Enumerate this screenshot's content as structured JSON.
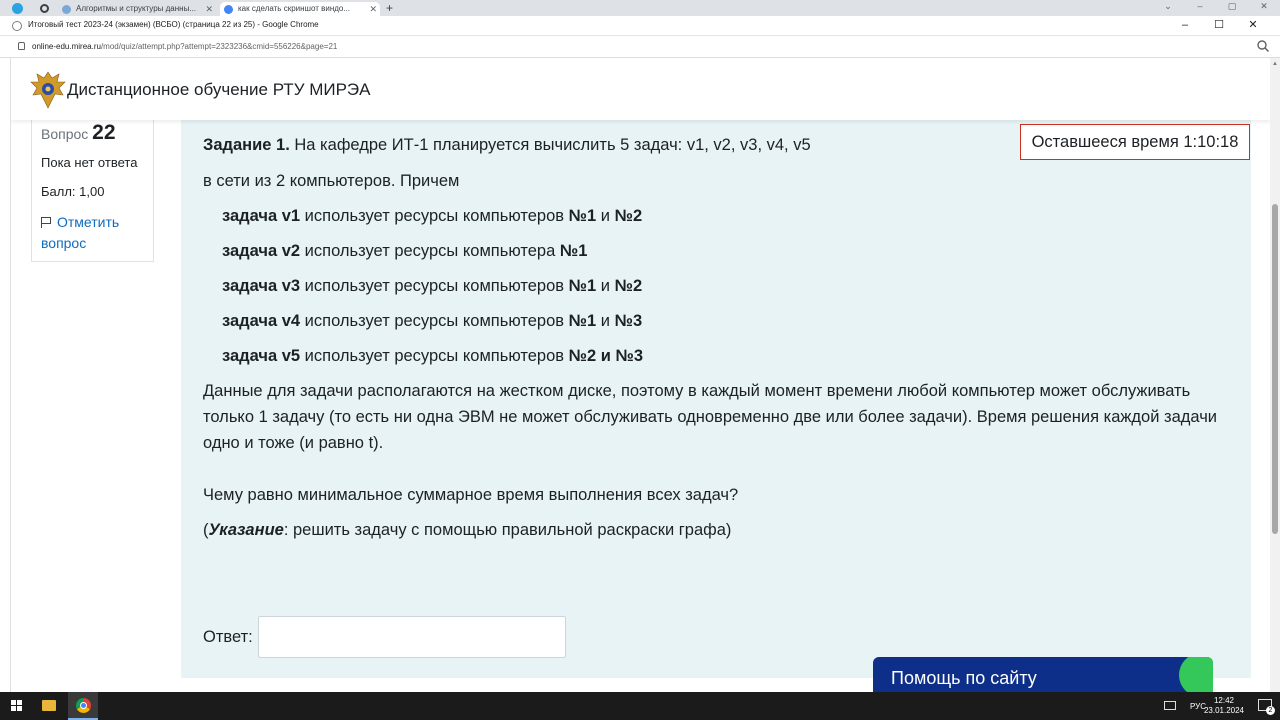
{
  "browser": {
    "tabs": [
      {
        "label": "Алгоритмы и структуры данны..."
      },
      {
        "label": "как сделать скриншот виндо..."
      }
    ],
    "window_title": "Итоговый тест 2023-24 (экзамен) (ВСБО) (страница 22 из 25) - Google Chrome",
    "url_host": "online-edu.mirea.ru",
    "url_path": "/mod/quiz/attempt.php?attempt=2323236&cmid=556226&page=21"
  },
  "site": {
    "name": "Дистанционное обучение РТУ МИРЭА"
  },
  "question_info": {
    "label": "Вопрос",
    "number": "22",
    "status": "Пока нет ответа",
    "grade": "Балл: 1,00",
    "flag_label": "Отметить вопрос"
  },
  "timer": {
    "label": "Оставшееся время",
    "value": "1:10:18"
  },
  "question": {
    "title_bold": "Задание 1.",
    "line1_rest": " На кафедре ИТ-1  планируется вычислить 5 задач: v1, v2, v3, v4, v5",
    "line2": "в сети из 2 компьютеров. Причем",
    "tasks": [
      {
        "name": "задача v1",
        "text": " использует ресурсы компьютеров  ",
        "bold_a": "№1",
        "mid": " и ",
        "bold_b": "№2"
      },
      {
        "name": "задача v2",
        "text": " использует ресурсы компьютера  ",
        "bold_a": "№1",
        "mid": "",
        "bold_b": ""
      },
      {
        "name": "задача v3",
        "text": " использует ресурсы компьютеров  ",
        "bold_a": "№1",
        "mid": " и ",
        "bold_b": "№2"
      },
      {
        "name": "задача v4",
        "text": " использует ресурсы компьютеров  ",
        "bold_a": "№1",
        "mid": " и ",
        "bold_b": "№3"
      },
      {
        "name": "задача v5",
        "text": " использует ресурсы компьютеров ",
        "bold_a": "№2 и №3",
        "mid": "",
        "bold_b": ""
      }
    ],
    "paragraph": "Данные для задачи располагаются на жестком диске, поэтому в каждый момент времени любой компьютер может обслуживать только 1 задачу (то есть ни одна ЭВМ не может обслуживать одновременно две или более задачи). Время решения каждой задачи одно и тоже (и равно t).",
    "ask": "Чему равно минимальное суммарное время выполнения всех задач?",
    "hint_open": "(",
    "hint_bold": "Указание",
    "hint_rest": ": решить задачу с помощью правильной раскраски графа)"
  },
  "answer": {
    "label": "Ответ:",
    "value": ""
  },
  "help_button": {
    "label": "Помощь по сайту"
  },
  "taskbar": {
    "lang": "РУС",
    "time": "12:42",
    "date": "23.01.2024",
    "notifications": "2"
  }
}
